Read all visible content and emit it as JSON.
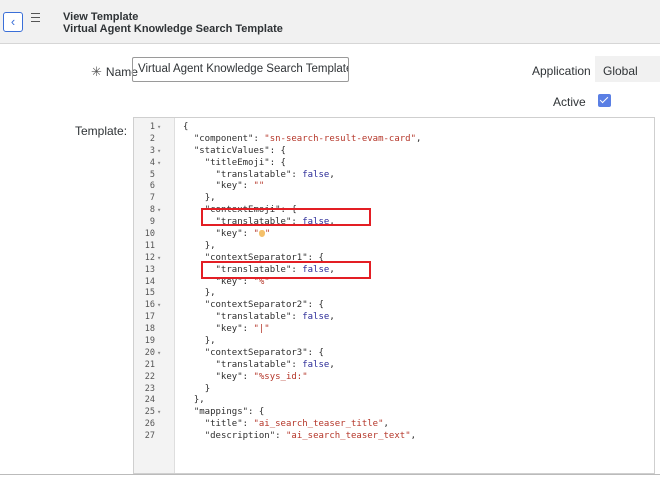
{
  "header": {
    "back_icon": "chevron-left-icon",
    "menu_icon": "hamburger-icon",
    "title": "View Template",
    "subtitle": "Virtual Agent Knowledge Search Template"
  },
  "form": {
    "name_required_mark": "✳",
    "name_label": "Name",
    "name_value": "Virtual Agent Knowledge Search Templat⁠e",
    "application_label": "Application",
    "application_value": "Global",
    "active_label": "Active",
    "active_checked": true,
    "template_label": "Template:"
  },
  "editor": {
    "lines": [
      {
        "n": "1",
        "fold": true,
        "parts": [
          [
            "p",
            "{"
          ]
        ]
      },
      {
        "n": "2",
        "fold": false,
        "parts": [
          [
            "i",
            "  "
          ],
          [
            "k",
            "\"component\""
          ],
          [
            "p",
            ": "
          ],
          [
            "s",
            "\"sn-search-result-evam-card\""
          ],
          [
            "p",
            ","
          ]
        ]
      },
      {
        "n": "3",
        "fold": true,
        "parts": [
          [
            "i",
            "  "
          ],
          [
            "k",
            "\"staticValues\""
          ],
          [
            "p",
            ": {"
          ]
        ]
      },
      {
        "n": "4",
        "fold": true,
        "parts": [
          [
            "i",
            "    "
          ],
          [
            "k",
            "\"titleEmoji\""
          ],
          [
            "p",
            ": {"
          ]
        ]
      },
      {
        "n": "5",
        "fold": false,
        "parts": [
          [
            "i",
            "      "
          ],
          [
            "k",
            "\"translatable\""
          ],
          [
            "p",
            ": "
          ],
          [
            "b",
            "false"
          ],
          [
            "p",
            ","
          ]
        ]
      },
      {
        "n": "6",
        "fold": false,
        "parts": [
          [
            "i",
            "      "
          ],
          [
            "k",
            "\"key\""
          ],
          [
            "p",
            ": "
          ],
          [
            "s",
            "\"\""
          ]
        ]
      },
      {
        "n": "7",
        "fold": false,
        "parts": [
          [
            "i",
            "    "
          ],
          [
            "p",
            "},"
          ]
        ]
      },
      {
        "n": "8",
        "fold": true,
        "parts": [
          [
            "i",
            "    "
          ],
          [
            "k",
            "\"contextEmoji\""
          ],
          [
            "p",
            ": {"
          ]
        ]
      },
      {
        "n": "9",
        "fold": false,
        "parts": [
          [
            "i",
            "      "
          ],
          [
            "k",
            "\"translatable\""
          ],
          [
            "p",
            ": "
          ],
          [
            "b",
            "false"
          ],
          [
            "p",
            ","
          ]
        ]
      },
      {
        "n": "10",
        "fold": false,
        "parts": [
          [
            "i",
            "      "
          ],
          [
            "k",
            "\"key\""
          ],
          [
            "p",
            ": "
          ],
          [
            "s",
            "\""
          ],
          [
            "e",
            "thumbs-up-emoji"
          ],
          [
            "s",
            "\""
          ]
        ]
      },
      {
        "n": "11",
        "fold": false,
        "parts": [
          [
            "i",
            "    "
          ],
          [
            "p",
            "},"
          ]
        ]
      },
      {
        "n": "12",
        "fold": true,
        "parts": [
          [
            "i",
            "    "
          ],
          [
            "k",
            "\"contextSeparator1\""
          ],
          [
            "p",
            ": {"
          ]
        ]
      },
      {
        "n": "13",
        "fold": false,
        "parts": [
          [
            "i",
            "      "
          ],
          [
            "k",
            "\"translatable\""
          ],
          [
            "p",
            ": "
          ],
          [
            "b",
            "false"
          ],
          [
            "p",
            ","
          ]
        ]
      },
      {
        "n": "14",
        "fold": false,
        "parts": [
          [
            "i",
            "      "
          ],
          [
            "k",
            "\"key\""
          ],
          [
            "p",
            ": "
          ],
          [
            "s",
            "\"%\""
          ]
        ]
      },
      {
        "n": "15",
        "fold": false,
        "parts": [
          [
            "i",
            "    "
          ],
          [
            "p",
            "},"
          ]
        ]
      },
      {
        "n": "16",
        "fold": true,
        "parts": [
          [
            "i",
            "    "
          ],
          [
            "k",
            "\"contextSeparator2\""
          ],
          [
            "p",
            ": {"
          ]
        ]
      },
      {
        "n": "17",
        "fold": false,
        "parts": [
          [
            "i",
            "      "
          ],
          [
            "k",
            "\"translatable\""
          ],
          [
            "p",
            ": "
          ],
          [
            "b",
            "false"
          ],
          [
            "p",
            ","
          ]
        ]
      },
      {
        "n": "18",
        "fold": false,
        "parts": [
          [
            "i",
            "      "
          ],
          [
            "k",
            "\"key\""
          ],
          [
            "p",
            ": "
          ],
          [
            "s",
            "\"|\""
          ]
        ]
      },
      {
        "n": "19",
        "fold": false,
        "parts": [
          [
            "i",
            "    "
          ],
          [
            "p",
            "},"
          ]
        ]
      },
      {
        "n": "20",
        "fold": true,
        "parts": [
          [
            "i",
            "    "
          ],
          [
            "k",
            "\"contextSeparator3\""
          ],
          [
            "p",
            ": {"
          ]
        ]
      },
      {
        "n": "21",
        "fold": false,
        "parts": [
          [
            "i",
            "      "
          ],
          [
            "k",
            "\"translatable\""
          ],
          [
            "p",
            ": "
          ],
          [
            "b",
            "false"
          ],
          [
            "p",
            ","
          ]
        ]
      },
      {
        "n": "22",
        "fold": false,
        "parts": [
          [
            "i",
            "      "
          ],
          [
            "k",
            "\"key\""
          ],
          [
            "p",
            ": "
          ],
          [
            "s",
            "\"%sys_id:\""
          ]
        ]
      },
      {
        "n": "23",
        "fold": false,
        "parts": [
          [
            "i",
            "    "
          ],
          [
            "p",
            "}"
          ]
        ]
      },
      {
        "n": "24",
        "fold": false,
        "parts": [
          [
            "i",
            "  "
          ],
          [
            "p",
            "},"
          ]
        ]
      },
      {
        "n": "25",
        "fold": true,
        "parts": [
          [
            "i",
            "  "
          ],
          [
            "k",
            "\"mappings\""
          ],
          [
            "p",
            ": {"
          ]
        ]
      },
      {
        "n": "26",
        "fold": false,
        "parts": [
          [
            "i",
            "    "
          ],
          [
            "k",
            "\"title\""
          ],
          [
            "p",
            ": "
          ],
          [
            "s",
            "\"ai_search_teaser_title\""
          ],
          [
            "p",
            ","
          ]
        ]
      },
      {
        "n": "27",
        "fold": false,
        "parts": [
          [
            "i",
            "    "
          ],
          [
            "k",
            "\"description\""
          ],
          [
            "p",
            ": "
          ],
          [
            "s",
            "\"ai_search_teaser_text\""
          ],
          [
            "p",
            ","
          ]
        ]
      }
    ],
    "highlight_color": "#e31e24"
  }
}
